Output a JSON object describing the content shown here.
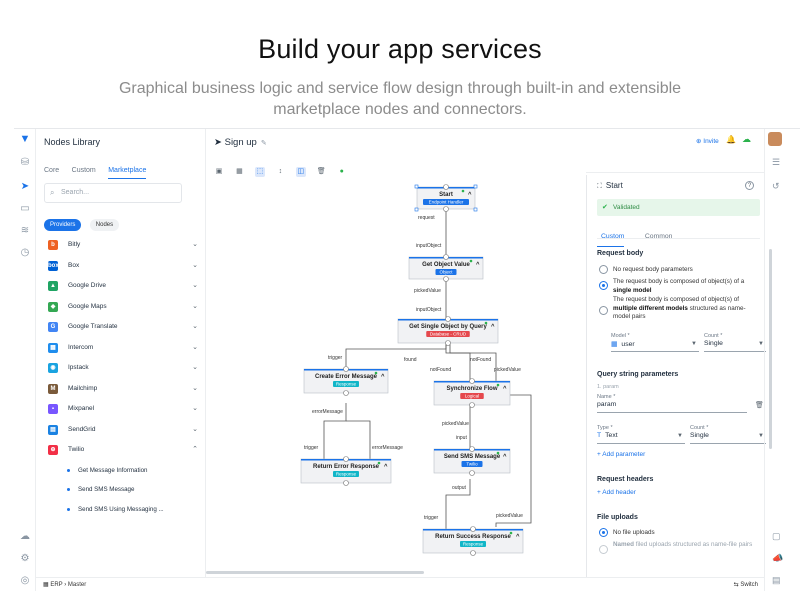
{
  "hero": {
    "title": "Build your app services",
    "subtitle": "Graphical business logic and service flow design through built-in and extensible marketplace nodes and connectors."
  },
  "library": {
    "title": "Nodes Library",
    "tabs": [
      "Core",
      "Custom",
      "Marketplace"
    ],
    "active_tab": "Marketplace",
    "search_placeholder": "Search...",
    "chips": [
      "Providers",
      "Nodes"
    ],
    "providers": [
      {
        "name": "Bitly",
        "color": "#ee6123",
        "glyph": "b"
      },
      {
        "name": "Box",
        "color": "#0061d5",
        "glyph": "box"
      },
      {
        "name": "Google Drive",
        "color": "#1fa463",
        "glyph": "▲"
      },
      {
        "name": "Google Maps",
        "color": "#34a853",
        "glyph": "◆"
      },
      {
        "name": "Google Translate",
        "color": "#4285f4",
        "glyph": "G"
      },
      {
        "name": "Intercom",
        "color": "#1f8ded",
        "glyph": "▦"
      },
      {
        "name": "Ipstack",
        "color": "#1aa3e0",
        "glyph": "◉"
      },
      {
        "name": "Mailchimp",
        "color": "#7a5a3a",
        "glyph": "M"
      },
      {
        "name": "Mixpanel",
        "color": "#7856ff",
        "glyph": "▪"
      },
      {
        "name": "SendGrid",
        "color": "#1a82e2",
        "glyph": "▤"
      },
      {
        "name": "Twilio",
        "color": "#f22f46",
        "glyph": "⊕"
      }
    ],
    "twilio_items": [
      "Get Message Information",
      "Send SMS Message",
      "Send SMS Using Messaging ..."
    ]
  },
  "canvas": {
    "title": "Sign up",
    "nodes": [
      {
        "id": "start",
        "title": "Start",
        "badge": "Endpoint Handler",
        "badge_color": "#1b73e8"
      },
      {
        "id": "getobj",
        "title": "Get Object Value",
        "badge": "Object",
        "badge_color": "#1b73e8"
      },
      {
        "id": "getsingle",
        "title": "Get Single Object by Query",
        "badge": "Database - CRUD",
        "badge_color": "#e5484d"
      },
      {
        "id": "createerr",
        "title": "Create Error Message",
        "badge": "Response",
        "badge_color": "#11b6c8"
      },
      {
        "id": "sync",
        "title": "Synchronize Flow",
        "badge": "Logical",
        "badge_color": "#e5484d"
      },
      {
        "id": "returnerr",
        "title": "Return Error Response",
        "badge": "Response",
        "badge_color": "#11b6c8"
      },
      {
        "id": "sms",
        "title": "Send SMS Message",
        "badge": "Twilio",
        "badge_color": "#1b73e8"
      },
      {
        "id": "returnok",
        "title": "Return Success Response",
        "badge": "Response",
        "badge_color": "#11b6c8"
      }
    ],
    "edge_labels": {
      "request": "request",
      "inputObject1": "inputObject",
      "pickedValue1": "pickedValue",
      "inputObject2": "inputObject",
      "trigger1": "trigger",
      "found": "found",
      "notFound1": "notFound",
      "notFound2": "notFound",
      "pickedValue2": "pickedValue",
      "errorMessage1": "errorMessage",
      "trigger2": "trigger",
      "errorMessage2": "errorMessage",
      "pickedValue3": "pickedValue",
      "input": "input",
      "output": "output",
      "pickedValue4": "pickedValue",
      "trigger3": "trigger"
    }
  },
  "topbar": {
    "invite": "Invite"
  },
  "panel": {
    "title": "Start",
    "validated": "Validated",
    "tabs": [
      "Custom",
      "Common"
    ],
    "request_body": {
      "heading": "Request body",
      "option1": "No request body parameters",
      "option2_a": "The request body is composed of object(s) of a ",
      "option2_b": "single model",
      "option3_a": "The request body is composed of object(s) of ",
      "option3_b": "multiple different models",
      "option3_c": " structured as name-model pairs",
      "model_label": "Model *",
      "model_value": "user",
      "count_label": "Count *",
      "count_value": "Single"
    },
    "query": {
      "heading": "Query string parameters",
      "subnote": "1. param",
      "name_label": "Name *",
      "name_value": "param",
      "type_label": "Type *",
      "type_value": "Text",
      "count_label": "Count *",
      "count_value": "Single",
      "add": "Add parameter"
    },
    "headers": {
      "heading": "Request headers",
      "add": "Add header"
    },
    "files": {
      "heading": "File uploads",
      "option1": "No file uploads",
      "option2_a": "Named",
      "option2_b": " filed uploads structured as name-file pairs"
    }
  },
  "status": {
    "breadcrumb": "ERP › Master",
    "switch": "Switch"
  }
}
